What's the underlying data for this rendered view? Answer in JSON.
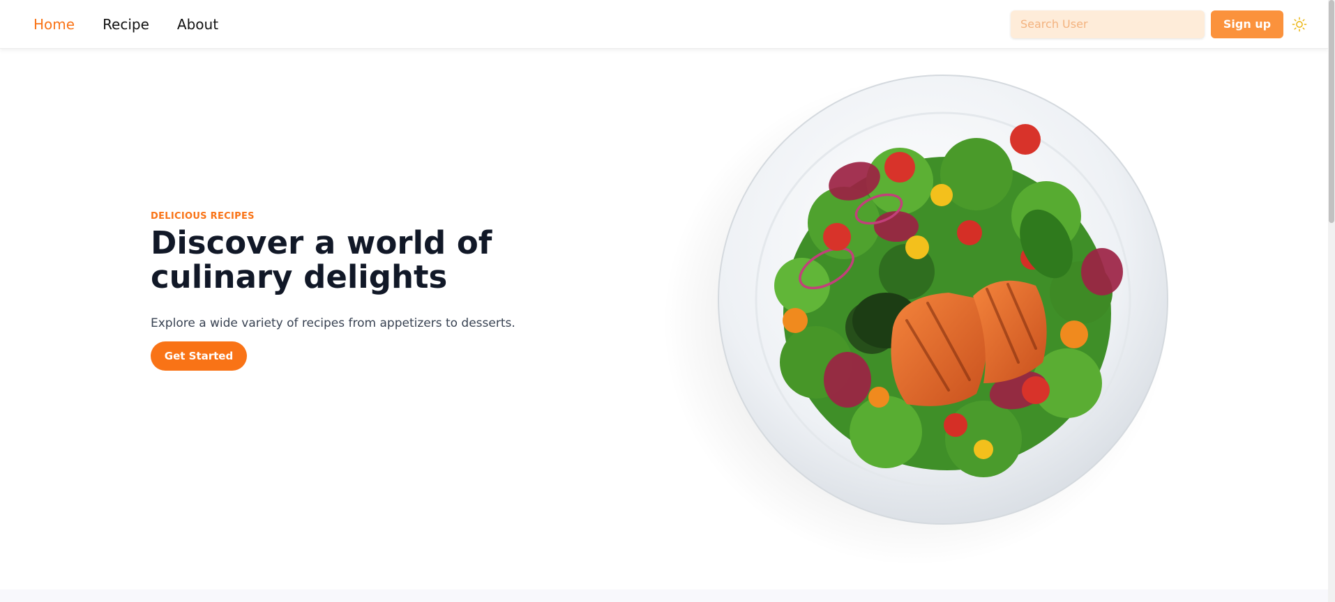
{
  "nav": {
    "links": [
      {
        "label": "Home",
        "active": true
      },
      {
        "label": "Recipe",
        "active": false
      },
      {
        "label": "About",
        "active": false
      }
    ],
    "search_placeholder": "Search User",
    "signup_label": "Sign up",
    "theme_icon": "sun-icon"
  },
  "hero": {
    "eyebrow": "DELICIOUS RECIPES",
    "title": "Discover a world of culinary delights",
    "description": "Explore a wide variety of recipes from appetizers to desserts.",
    "cta_label": "Get Started",
    "image_icon": "salmon-salad-plate"
  },
  "colors": {
    "accent": "#f97316",
    "accent_light": "#fb923c",
    "search_bg": "#feecd9",
    "heading": "#111827"
  }
}
